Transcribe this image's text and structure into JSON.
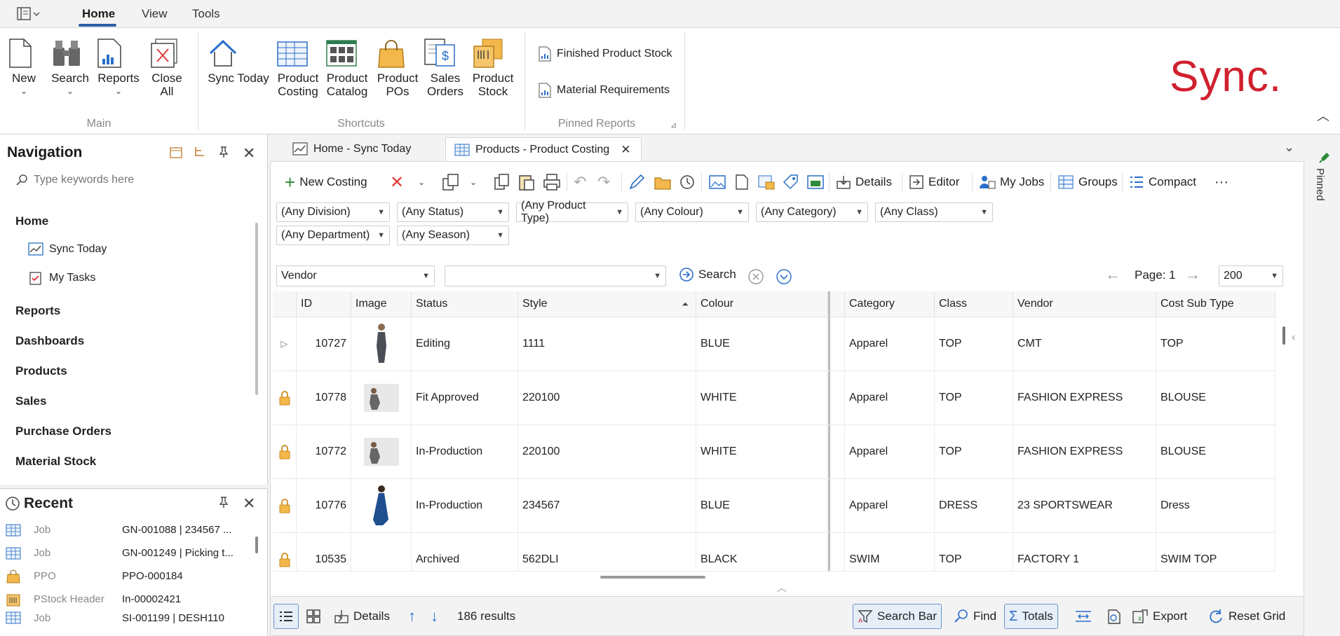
{
  "menu": {
    "tabs": [
      "Home",
      "View",
      "Tools"
    ]
  },
  "ribbon": {
    "main": {
      "new": "New",
      "search": "Search",
      "reports": "Reports",
      "close_all_1": "Close",
      "close_all_2": "All",
      "label": "Main"
    },
    "shortcuts": {
      "sync_today": "Sync Today",
      "product_costing_1": "Product",
      "product_costing_2": "Costing",
      "product_catalog_1": "Product",
      "product_catalog_2": "Catalog",
      "product_pos_1": "Product",
      "product_pos_2": "POs",
      "sales_orders_1": "Sales",
      "sales_orders_2": "Orders",
      "product_stock_1": "Product",
      "product_stock_2": "Stock",
      "label": "Shortcuts"
    },
    "pinned": {
      "item1": "Finished Product Stock",
      "item2": "Material Requirements",
      "label": "Pinned Reports"
    },
    "brand": "Sync.",
    "brand_color": "#d0202e"
  },
  "navigation": {
    "title": "Navigation",
    "search_placeholder": "Type keywords here",
    "home": "Home",
    "sync_today": "Sync Today",
    "my_tasks": "My Tasks",
    "reports": "Reports",
    "dashboards": "Dashboards",
    "products": "Products",
    "sales": "Sales",
    "purchase_orders": "Purchase Orders",
    "material_stock": "Material Stock"
  },
  "recent": {
    "title": "Recent",
    "items": [
      {
        "type": "Job",
        "value": "GN-001088 | 234567 ..."
      },
      {
        "type": "Job",
        "value": "GN-001249 | Picking t..."
      },
      {
        "type": "PPO",
        "value": "PPO-000184"
      },
      {
        "type": "PStock Header",
        "value": "In-00002421"
      },
      {
        "type": "Job",
        "value": "SI-001199 | DESH110"
      }
    ]
  },
  "doc_tabs": {
    "tab1": "Home - Sync Today",
    "tab2": "Products - Product Costing"
  },
  "toolbar": {
    "new_costing": "New Costing",
    "details": "Details",
    "editor": "Editor",
    "my_jobs": "My Jobs",
    "groups": "Groups",
    "compact": "Compact",
    "more": "···"
  },
  "filters": {
    "division": "(Any Division)",
    "status": "(Any Status)",
    "product_type": "(Any Product Type)",
    "colour": "(Any Colour)",
    "category": "(Any Category)",
    "class": "(Any Class)",
    "department": "(Any Department)",
    "season": "(Any Season)"
  },
  "search": {
    "field": "Vendor",
    "value": "",
    "button": "Search",
    "page": "Page: 1",
    "page_size": "200"
  },
  "grid": {
    "headers": [
      "ID",
      "Image",
      "Status",
      "Style",
      "Colour",
      "Category",
      "Class",
      "Vendor",
      "Cost Sub Type"
    ],
    "rows": [
      {
        "locked": false,
        "id": "10727",
        "status": "Editing",
        "style": "1111",
        "colour": "BLUE",
        "category": "Apparel",
        "class": "TOP",
        "vendor": "CMT",
        "cost_sub_type": "TOP"
      },
      {
        "locked": true,
        "id": "10778",
        "status": "Fit Approved",
        "style": "220100",
        "colour": "WHITE",
        "category": "Apparel",
        "class": "TOP",
        "vendor": "FASHION EXPRESS",
        "cost_sub_type": "BLOUSE"
      },
      {
        "locked": true,
        "id": "10772",
        "status": "In-Production",
        "style": "220100",
        "colour": "WHITE",
        "category": "Apparel",
        "class": "TOP",
        "vendor": "FASHION EXPRESS",
        "cost_sub_type": "BLOUSE"
      },
      {
        "locked": true,
        "id": "10776",
        "status": "In-Production",
        "style": "234567",
        "colour": "BLUE",
        "category": "Apparel",
        "class": "DRESS",
        "vendor": "23 SPORTSWEAR",
        "cost_sub_type": "Dress"
      },
      {
        "locked": true,
        "id": "10535",
        "status": "Archived",
        "style": "562DLI",
        "colour": "BLACK",
        "category": "SWIM",
        "class": "TOP",
        "vendor": "FACTORY 1",
        "cost_sub_type": "SWIM TOP"
      }
    ]
  },
  "statusbar": {
    "details": "Details",
    "results": "186 results",
    "search_bar": "Search Bar",
    "find": "Find",
    "totals": "Totals",
    "export": "Export",
    "reset_grid": "Reset Grid"
  },
  "side_strip": {
    "pinned": "Pinned"
  }
}
